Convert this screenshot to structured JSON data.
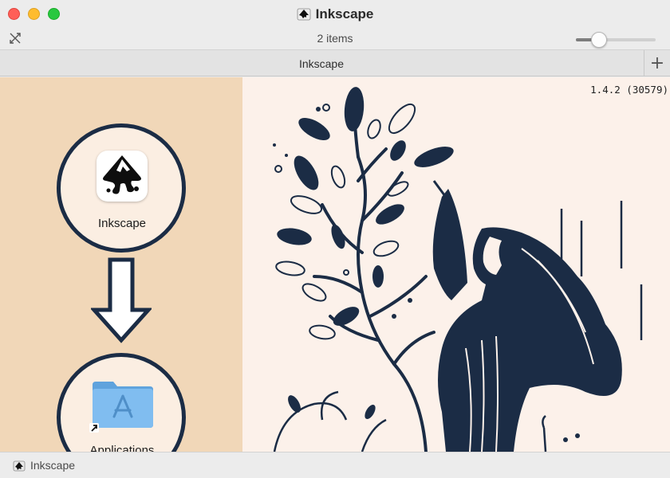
{
  "window": {
    "title": "Inkscape",
    "icon": "inkscape-icon"
  },
  "toolbar": {
    "item_count": "2 items",
    "icon_size_fraction": 0.24
  },
  "tabbar": {
    "active_tab": "Inkscape",
    "add_label": "+"
  },
  "dmg": {
    "version": "1.4.2 (30579)",
    "app_label": "Inkscape",
    "folder_label": "Applications"
  },
  "statusbar": {
    "path": "Inkscape"
  },
  "colors": {
    "left_panel": "#f1d7b8",
    "right_panel": "#fcf1ea",
    "ink": "#1b2c45",
    "folder": "#74b3ea"
  }
}
